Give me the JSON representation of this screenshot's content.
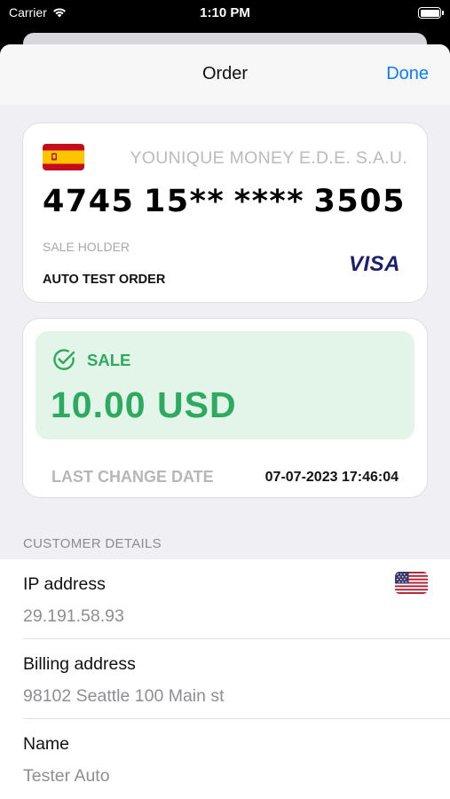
{
  "status_bar": {
    "carrier": "Carrier",
    "time": "1:10 PM"
  },
  "nav": {
    "title": "Order",
    "done_label": "Done"
  },
  "card": {
    "bank_name": "YOUNIQUE MONEY E.D.E. S.A.U.",
    "pan_groups": [
      "4745",
      "15**",
      "****",
      "3505"
    ],
    "holder_label": "SALE HOLDER",
    "holder_name": "AUTO TEST ORDER",
    "network": "VISA",
    "flag": "spain-flag-icon"
  },
  "transaction": {
    "status": "SALE",
    "amount": "10.00  USD",
    "last_change_label": "LAST CHANGE DATE",
    "last_change_value": "07-07-2023 17:46:04",
    "status_color": "#2ea960"
  },
  "customer": {
    "section_title": "CUSTOMER DETAILS",
    "rows": [
      {
        "title": "IP address",
        "value": "29.191.58.93",
        "icon": "us-flag-icon"
      },
      {
        "title": "Billing address",
        "value": "98102 Seattle 100 Main st"
      },
      {
        "title": "Name",
        "value": "Tester Auto"
      }
    ]
  },
  "colors": {
    "accent": "#0a7cff",
    "success": "#2ea960",
    "success_bg": "#e3f4e9"
  }
}
